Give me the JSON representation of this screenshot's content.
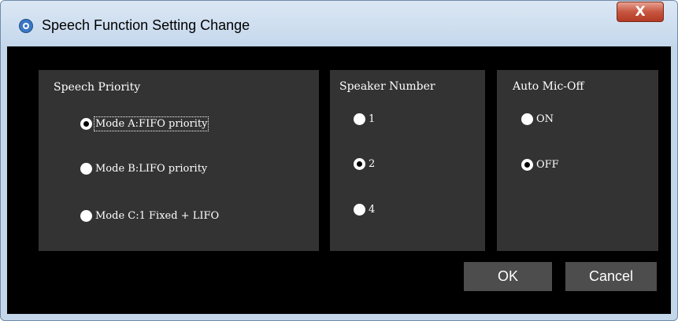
{
  "window": {
    "title": "Speech Function Setting Change",
    "close_label": "X"
  },
  "speech_priority": {
    "legend": "Speech Priority",
    "options": [
      {
        "label": "Mode A:FIFO priority",
        "checked": true
      },
      {
        "label": "Mode B:LIFO priority",
        "checked": false
      },
      {
        "label": "Mode C:1 Fixed + LIFO",
        "checked": false
      }
    ]
  },
  "speaker_number": {
    "legend": "Speaker Number",
    "options": [
      {
        "label": "1",
        "checked": false
      },
      {
        "label": "2",
        "checked": true
      },
      {
        "label": "4",
        "checked": false
      }
    ]
  },
  "auto_mic_off": {
    "legend": "Auto Mic-Off",
    "options": [
      {
        "label": "ON",
        "checked": false
      },
      {
        "label": "OFF",
        "checked": true
      }
    ]
  },
  "buttons": {
    "ok": "OK",
    "cancel": "Cancel"
  },
  "colors": {
    "client_bg": "#000000",
    "group_bg": "#333333",
    "button_bg": "#4d4d4d",
    "text": "#ffffff"
  }
}
